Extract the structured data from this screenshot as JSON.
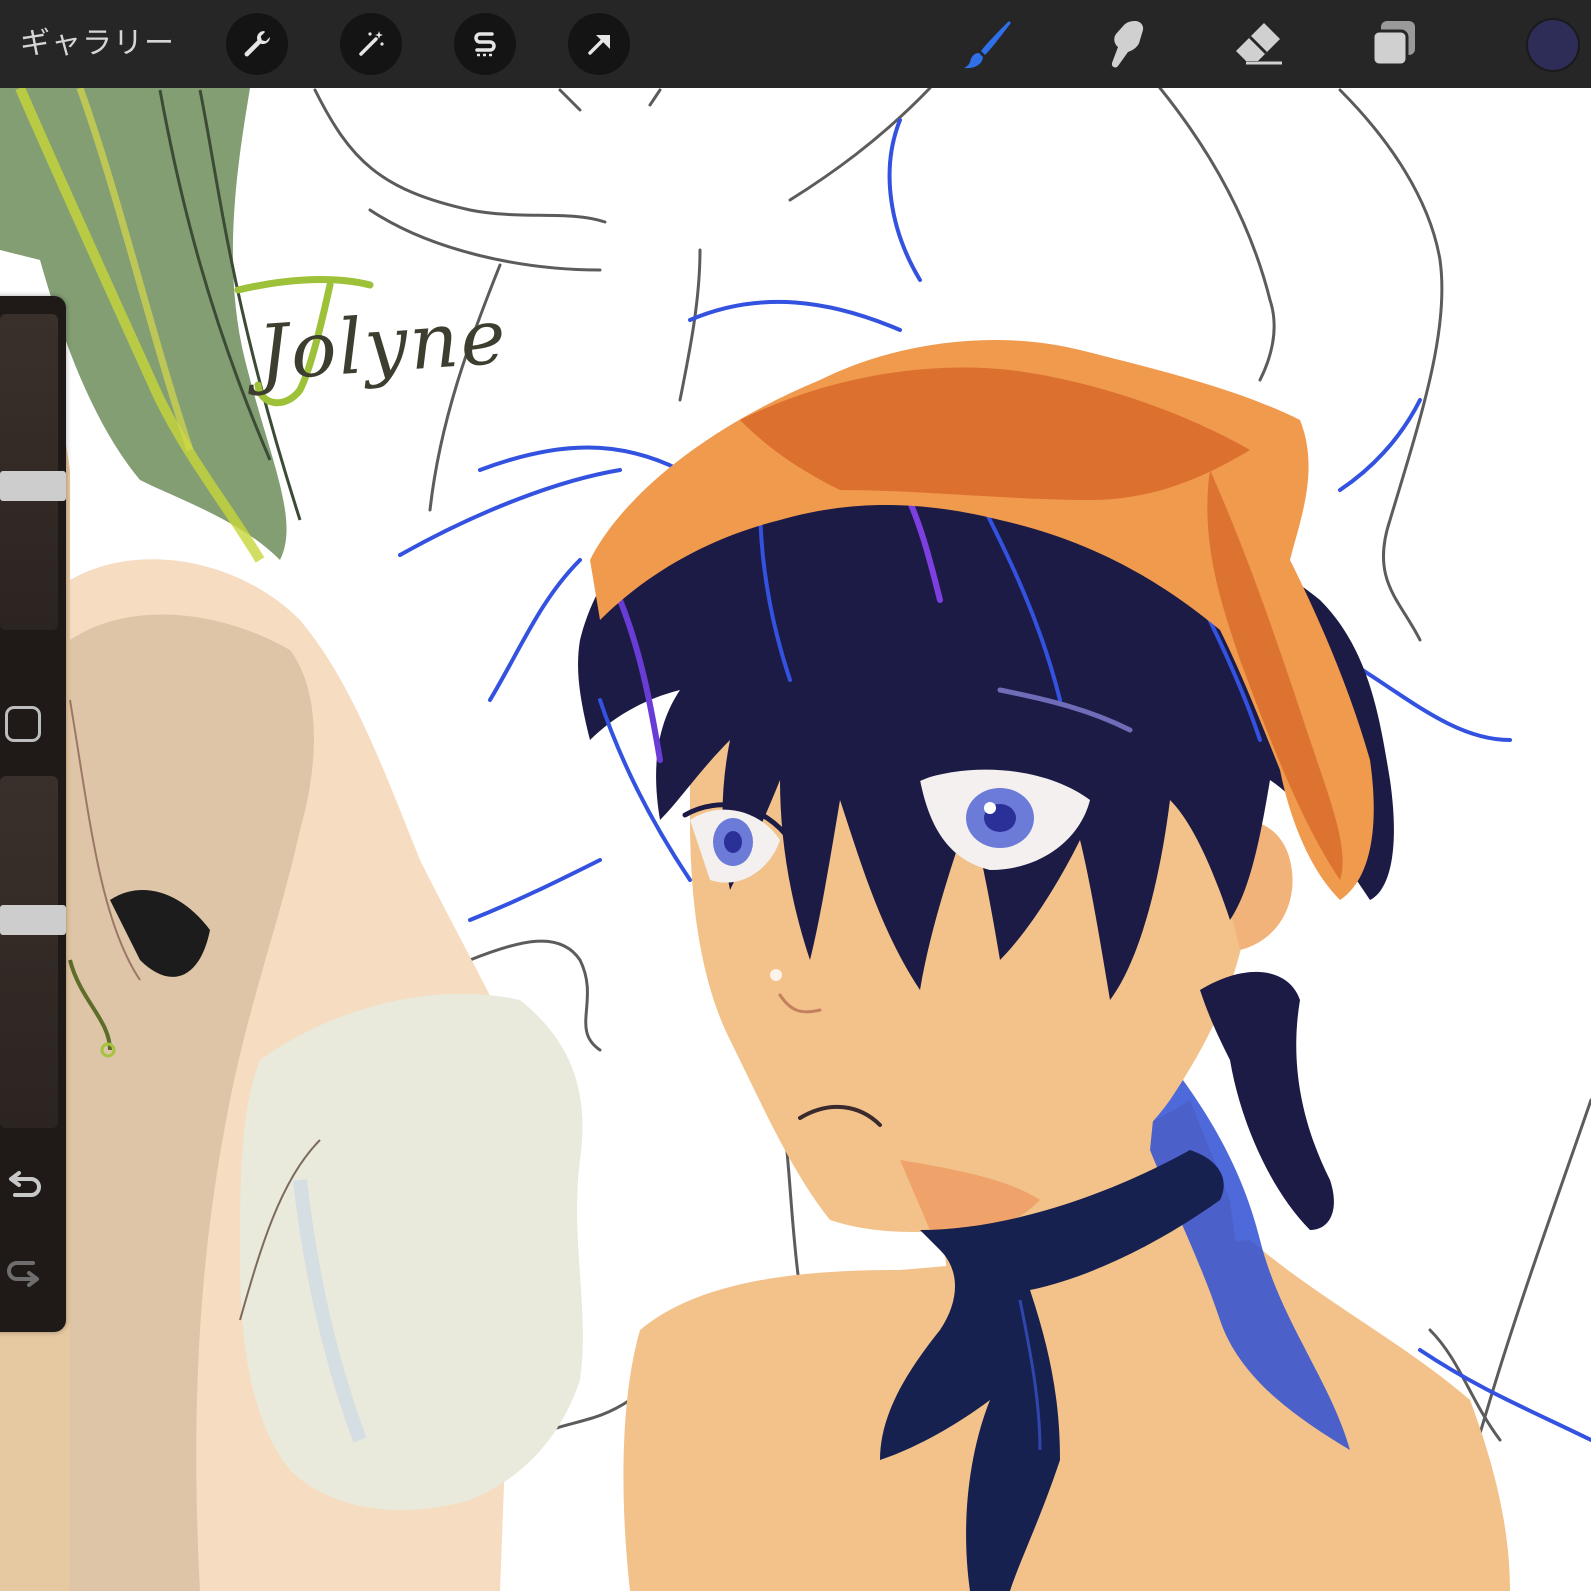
{
  "toolbar": {
    "gallery_label": "ギャラリー",
    "left_actions": [
      {
        "name": "actions",
        "icon": "wrench-icon"
      },
      {
        "name": "adjustments",
        "icon": "magic-wand-icon"
      },
      {
        "name": "selection",
        "icon": "selection-s-icon"
      },
      {
        "name": "transform",
        "icon": "arrow-cursor-icon"
      }
    ],
    "right_tools": [
      {
        "name": "brush",
        "icon": "brush-icon",
        "active": true
      },
      {
        "name": "smudge",
        "icon": "smudge-finger-icon",
        "active": false
      },
      {
        "name": "eraser",
        "icon": "eraser-icon",
        "active": false
      },
      {
        "name": "layers",
        "icon": "layers-icon",
        "active": false
      }
    ],
    "current_color": "#2e2d58",
    "active_tool_color": "#2f6fe8"
  },
  "canvas": {
    "handwritten_text": "Jolyne"
  },
  "sidebar": {
    "brush_size_level": 0.45,
    "opacity_level": 0.6,
    "icons": [
      "square-modify-icon",
      "undo-icon",
      "redo-icon"
    ]
  }
}
